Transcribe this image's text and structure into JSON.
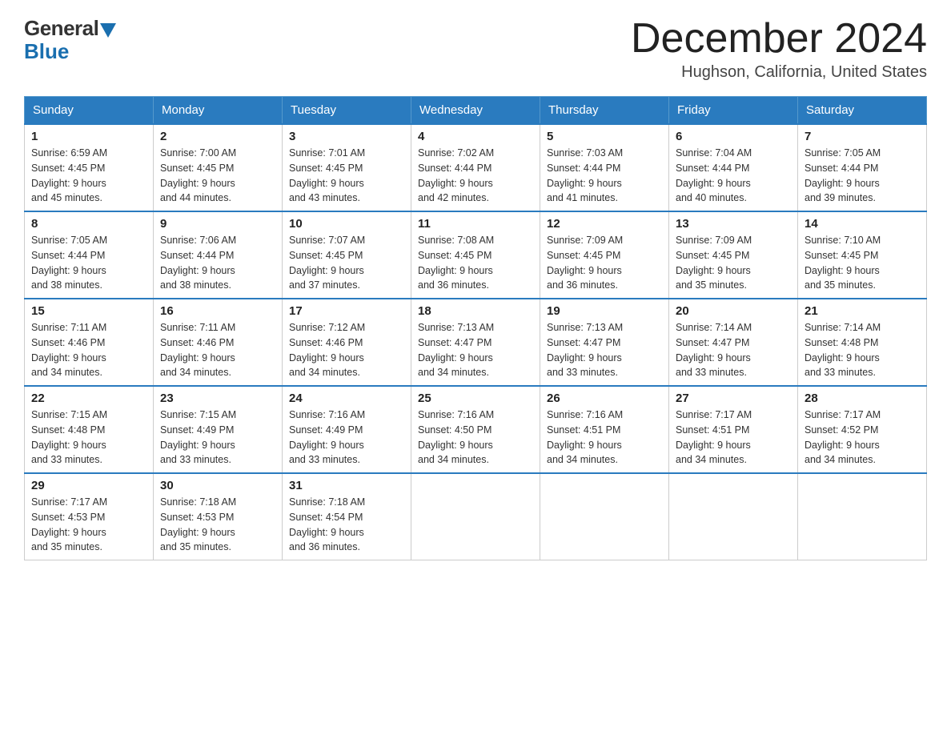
{
  "header": {
    "logo_general": "General",
    "logo_blue": "Blue",
    "month_title": "December 2024",
    "location": "Hughson, California, United States"
  },
  "days_of_week": [
    "Sunday",
    "Monday",
    "Tuesday",
    "Wednesday",
    "Thursday",
    "Friday",
    "Saturday"
  ],
  "weeks": [
    [
      {
        "day": "1",
        "sunrise": "6:59 AM",
        "sunset": "4:45 PM",
        "daylight": "9 hours and 45 minutes."
      },
      {
        "day": "2",
        "sunrise": "7:00 AM",
        "sunset": "4:45 PM",
        "daylight": "9 hours and 44 minutes."
      },
      {
        "day": "3",
        "sunrise": "7:01 AM",
        "sunset": "4:45 PM",
        "daylight": "9 hours and 43 minutes."
      },
      {
        "day": "4",
        "sunrise": "7:02 AM",
        "sunset": "4:44 PM",
        "daylight": "9 hours and 42 minutes."
      },
      {
        "day": "5",
        "sunrise": "7:03 AM",
        "sunset": "4:44 PM",
        "daylight": "9 hours and 41 minutes."
      },
      {
        "day": "6",
        "sunrise": "7:04 AM",
        "sunset": "4:44 PM",
        "daylight": "9 hours and 40 minutes."
      },
      {
        "day": "7",
        "sunrise": "7:05 AM",
        "sunset": "4:44 PM",
        "daylight": "9 hours and 39 minutes."
      }
    ],
    [
      {
        "day": "8",
        "sunrise": "7:05 AM",
        "sunset": "4:44 PM",
        "daylight": "9 hours and 38 minutes."
      },
      {
        "day": "9",
        "sunrise": "7:06 AM",
        "sunset": "4:44 PM",
        "daylight": "9 hours and 38 minutes."
      },
      {
        "day": "10",
        "sunrise": "7:07 AM",
        "sunset": "4:45 PM",
        "daylight": "9 hours and 37 minutes."
      },
      {
        "day": "11",
        "sunrise": "7:08 AM",
        "sunset": "4:45 PM",
        "daylight": "9 hours and 36 minutes."
      },
      {
        "day": "12",
        "sunrise": "7:09 AM",
        "sunset": "4:45 PM",
        "daylight": "9 hours and 36 minutes."
      },
      {
        "day": "13",
        "sunrise": "7:09 AM",
        "sunset": "4:45 PM",
        "daylight": "9 hours and 35 minutes."
      },
      {
        "day": "14",
        "sunrise": "7:10 AM",
        "sunset": "4:45 PM",
        "daylight": "9 hours and 35 minutes."
      }
    ],
    [
      {
        "day": "15",
        "sunrise": "7:11 AM",
        "sunset": "4:46 PM",
        "daylight": "9 hours and 34 minutes."
      },
      {
        "day": "16",
        "sunrise": "7:11 AM",
        "sunset": "4:46 PM",
        "daylight": "9 hours and 34 minutes."
      },
      {
        "day": "17",
        "sunrise": "7:12 AM",
        "sunset": "4:46 PM",
        "daylight": "9 hours and 34 minutes."
      },
      {
        "day": "18",
        "sunrise": "7:13 AM",
        "sunset": "4:47 PM",
        "daylight": "9 hours and 34 minutes."
      },
      {
        "day": "19",
        "sunrise": "7:13 AM",
        "sunset": "4:47 PM",
        "daylight": "9 hours and 33 minutes."
      },
      {
        "day": "20",
        "sunrise": "7:14 AM",
        "sunset": "4:47 PM",
        "daylight": "9 hours and 33 minutes."
      },
      {
        "day": "21",
        "sunrise": "7:14 AM",
        "sunset": "4:48 PM",
        "daylight": "9 hours and 33 minutes."
      }
    ],
    [
      {
        "day": "22",
        "sunrise": "7:15 AM",
        "sunset": "4:48 PM",
        "daylight": "9 hours and 33 minutes."
      },
      {
        "day": "23",
        "sunrise": "7:15 AM",
        "sunset": "4:49 PM",
        "daylight": "9 hours and 33 minutes."
      },
      {
        "day": "24",
        "sunrise": "7:16 AM",
        "sunset": "4:49 PM",
        "daylight": "9 hours and 33 minutes."
      },
      {
        "day": "25",
        "sunrise": "7:16 AM",
        "sunset": "4:50 PM",
        "daylight": "9 hours and 34 minutes."
      },
      {
        "day": "26",
        "sunrise": "7:16 AM",
        "sunset": "4:51 PM",
        "daylight": "9 hours and 34 minutes."
      },
      {
        "day": "27",
        "sunrise": "7:17 AM",
        "sunset": "4:51 PM",
        "daylight": "9 hours and 34 minutes."
      },
      {
        "day": "28",
        "sunrise": "7:17 AM",
        "sunset": "4:52 PM",
        "daylight": "9 hours and 34 minutes."
      }
    ],
    [
      {
        "day": "29",
        "sunrise": "7:17 AM",
        "sunset": "4:53 PM",
        "daylight": "9 hours and 35 minutes."
      },
      {
        "day": "30",
        "sunrise": "7:18 AM",
        "sunset": "4:53 PM",
        "daylight": "9 hours and 35 minutes."
      },
      {
        "day": "31",
        "sunrise": "7:18 AM",
        "sunset": "4:54 PM",
        "daylight": "9 hours and 36 minutes."
      },
      null,
      null,
      null,
      null
    ]
  ],
  "labels": {
    "sunrise": "Sunrise:",
    "sunset": "Sunset:",
    "daylight": "Daylight:"
  }
}
